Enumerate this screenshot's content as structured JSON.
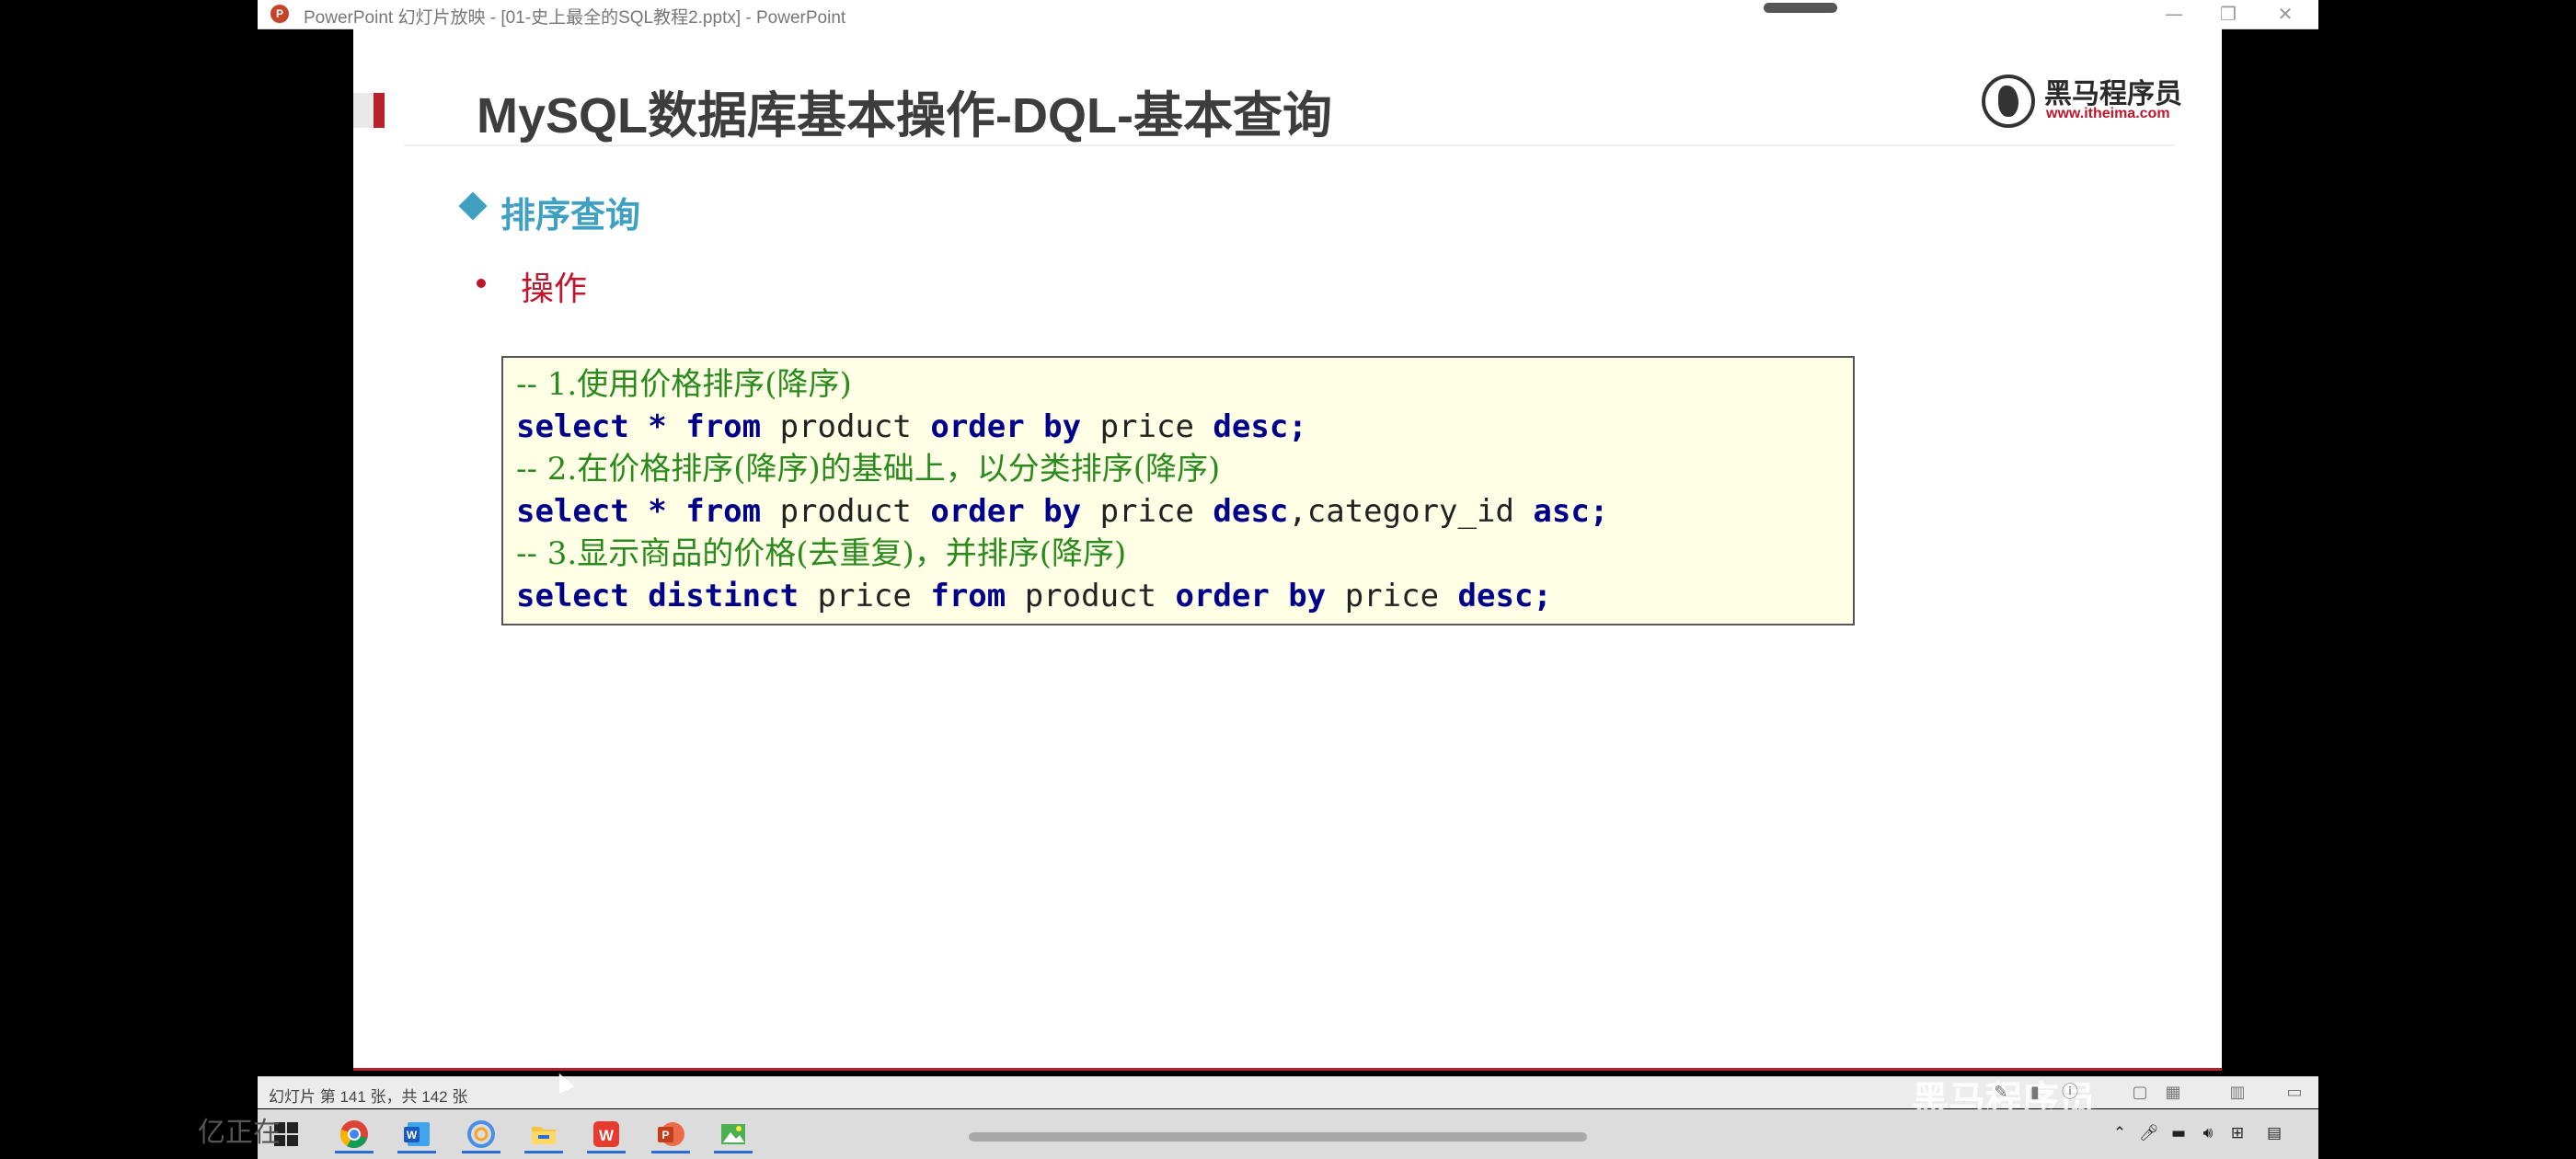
{
  "window": {
    "title": "PowerPoint 幻灯片放映 - [01-史上最全的SQL教程2.pptx] - PowerPoint",
    "app_icon": "P",
    "minimize": "—",
    "restore": "❐",
    "close": "✕"
  },
  "slide": {
    "title": "MySQL数据库基本操作-DQL-基本查询",
    "logo_cn": "黑马程序员",
    "logo_url": "www.itheima.com",
    "section_title": "排序查询",
    "bullet": "操作",
    "code": [
      {
        "type": "comment",
        "text": "-- 1.使用价格排序(降序)"
      },
      {
        "type": "code",
        "parts": [
          {
            "kw": true,
            "t": "select * from"
          },
          {
            "kw": false,
            "t": " product "
          },
          {
            "kw": true,
            "t": "order by"
          },
          {
            "kw": false,
            "t": " price "
          },
          {
            "kw": true,
            "t": "desc;"
          }
        ]
      },
      {
        "type": "comment",
        "text": "-- 2.在价格排序(降序)的基础上，以分类排序(降序)"
      },
      {
        "type": "code",
        "parts": [
          {
            "kw": true,
            "t": "select * from"
          },
          {
            "kw": false,
            "t": " product "
          },
          {
            "kw": true,
            "t": "order by"
          },
          {
            "kw": false,
            "t": " price "
          },
          {
            "kw": true,
            "t": "desc"
          },
          {
            "kw": false,
            "t": ",category_id "
          },
          {
            "kw": true,
            "t": "asc;"
          }
        ]
      },
      {
        "type": "comment",
        "text": "-- 3.显示商品的价格(去重复)，并排序(降序)"
      },
      {
        "type": "code",
        "parts": [
          {
            "kw": true,
            "t": "select distinct"
          },
          {
            "kw": false,
            "t": " price "
          },
          {
            "kw": true,
            "t": "from"
          },
          {
            "kw": false,
            "t": " product "
          },
          {
            "kw": true,
            "t": "order by"
          },
          {
            "kw": false,
            "t": " price "
          },
          {
            "kw": true,
            "t": "desc;"
          }
        ]
      }
    ]
  },
  "statusbar": {
    "slide_counter": "幻灯片 第 141 张，共 142 张",
    "watermark": "黑马程序员",
    "icons": [
      "pen-icon",
      "pointer-icon",
      "info-icon",
      "fit-icon",
      "grid-icon",
      "reading-view-icon",
      "slideshow-icon"
    ]
  },
  "taskbar": {
    "overlay_text": "亿正在",
    "apps": [
      "chrome-icon",
      "word-icon",
      "browser-icon",
      "file-explorer-icon",
      "wps-icon",
      "powerpoint-icon",
      "image-viewer-icon"
    ],
    "tray": [
      "chevron-up-icon",
      "microphone-icon",
      "battery-icon",
      "volume-icon",
      "ime-icon",
      "notification-icon"
    ]
  },
  "colors": {
    "accent_red": "#b8202a",
    "section_blue": "#3fa0c2",
    "keyword": "#00008b",
    "comment": "#2b8a1e",
    "code_bg": "#ffffe6"
  }
}
